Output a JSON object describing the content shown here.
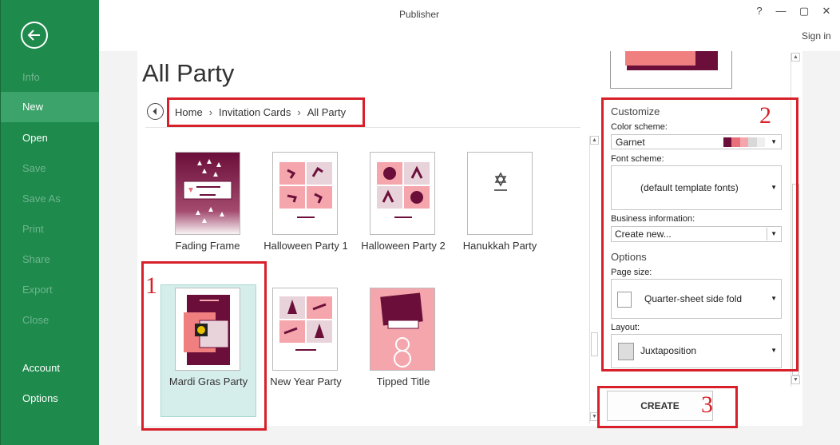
{
  "app_title": "Publisher",
  "window_controls": {
    "help": "?",
    "minimize": "—",
    "restore": "▢",
    "close": "✕"
  },
  "signin_label": "Sign in",
  "sidebar": {
    "items": [
      {
        "label": "Info",
        "state": "disabled"
      },
      {
        "label": "New",
        "state": "active"
      },
      {
        "label": "Open",
        "state": "normal"
      },
      {
        "label": "Save",
        "state": "disabled"
      },
      {
        "label": "Save As",
        "state": "disabled"
      },
      {
        "label": "Print",
        "state": "disabled"
      },
      {
        "label": "Share",
        "state": "disabled"
      },
      {
        "label": "Export",
        "state": "disabled"
      },
      {
        "label": "Close",
        "state": "disabled"
      },
      {
        "label": "Account",
        "state": "normal"
      },
      {
        "label": "Options",
        "state": "normal"
      }
    ]
  },
  "page_title": "All Party",
  "breadcrumb": [
    "Home",
    "Invitation Cards",
    "All Party"
  ],
  "breadcrumb_sep": "›",
  "templates": [
    {
      "label": "Fading Frame",
      "selected": false
    },
    {
      "label": "Halloween Party 1",
      "selected": false
    },
    {
      "label": "Halloween Party 2",
      "selected": false
    },
    {
      "label": "Hanukkah Party",
      "selected": false
    },
    {
      "label": "Mardi Gras Party",
      "selected": true
    },
    {
      "label": "New Year Party",
      "selected": false
    },
    {
      "label": "Tipped Title",
      "selected": false
    }
  ],
  "customize": {
    "heading": "Customize",
    "color_scheme_label": "Color scheme:",
    "color_scheme_value": "Garnet",
    "color_swatches": [
      "#6b0f3a",
      "#e8707a",
      "#f4a6ac",
      "#d8d8d8",
      "#ffffff"
    ],
    "font_scheme_label": "Font scheme:",
    "font_scheme_value": "(default template fonts)",
    "business_info_label": "Business information:",
    "business_info_value": "Create new...",
    "options_heading": "Options",
    "page_size_label": "Page size:",
    "page_size_value": "Quarter-sheet side fold",
    "layout_label": "Layout:",
    "layout_value": "Juxtaposition"
  },
  "create_label": "CREATE",
  "annotations": [
    "1",
    "2",
    "3"
  ],
  "colors": {
    "sidebar": "#1e8a4c",
    "accent_red": "#d8202a",
    "garnet": "#6b0f3a",
    "salmon": "#f07f80"
  }
}
